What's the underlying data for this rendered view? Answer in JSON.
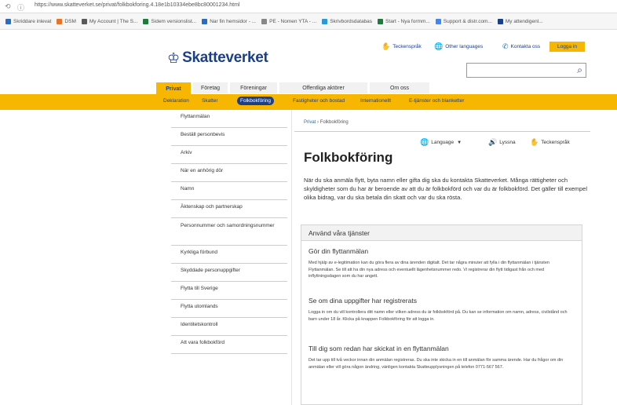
{
  "browser": {
    "url": "https://www.skatteverket.se/privat/folkbokforing.4.18e1b10334ebe8bc80001234.html",
    "bookmarks": [
      {
        "label": "Skriddare inlevat",
        "color": "#2a6cc4"
      },
      {
        "label": "DSM",
        "color": "#e8742a"
      },
      {
        "label": "My Account | The S...",
        "color": "#5a5a5a"
      },
      {
        "label": "Sidem versionslist...",
        "color": "#1f7a3e"
      },
      {
        "label": "Nar fin hemsidor - ...",
        "color": "#2a6cc4"
      },
      {
        "label": "PE - Nomen YTA - ...",
        "color": "#888888"
      },
      {
        "label": "Skrivbordsdatabas",
        "color": "#2a9ad6"
      },
      {
        "label": "Start - Nya formm...",
        "color": "#1f7a3e"
      },
      {
        "label": "Support & distr.com...",
        "color": "#4285f4"
      },
      {
        "label": "My attendigenl...",
        "color": "#1c3f8a"
      }
    ]
  },
  "header": {
    "logo_text": "Skatteverket",
    "utilities": {
      "sign_language": "Teckenspråk",
      "other_languages": "Other languages",
      "contact": "Kontakta oss",
      "login": "Logga in"
    },
    "search_placeholder": ""
  },
  "tabs": [
    {
      "label": "Privat",
      "active": true
    },
    {
      "label": "Företag",
      "active": false
    },
    {
      "label": "Föreningar",
      "active": false
    },
    {
      "label": "Offentliga aktörer",
      "active": false
    },
    {
      "label": "Om oss",
      "active": false
    }
  ],
  "subnav": [
    {
      "label": "Deklaration",
      "active": false
    },
    {
      "label": "Skatter",
      "active": false
    },
    {
      "label": "Folkbokföring",
      "active": true
    },
    {
      "label": "Fastigheter och bostad",
      "active": false
    },
    {
      "label": "Internationellt",
      "active": false
    },
    {
      "label": "E-tjänster och blanketter",
      "active": false
    }
  ],
  "sidebar": [
    "Flyttanmälan",
    "Beställ personbevis",
    "Arkiv",
    "När en anhörig dör",
    "Namn",
    "Äktenskap och partnerskap",
    "Personnummer och samordningsnummer",
    "Kyrkliga förbund",
    "Skyddade personuppgifter",
    "Flytta till Sverige",
    "Flytta utomlands",
    "Identitetskontroll",
    "Att vara folkbokförd"
  ],
  "main": {
    "breadcrumb": {
      "home": "Privat",
      "current": "Folkbokföring"
    },
    "tools": {
      "language": "Language",
      "listen": "Lyssna",
      "sign_language": "Teckenspråk"
    },
    "title": "Folkbokföring",
    "intro": "När du ska anmäla flytt, byta namn eller gifta dig ska du kontakta Skatteverket. Många rättigheter och skyldigheter som du har är beroende av att du är folkbokförd och var du är folkbokförd. Det gäller till exempel olika bidrag, var du ska betala din skatt och var du ska rösta.",
    "services": {
      "heading": "Använd våra tjänster",
      "items": [
        {
          "title": "Gör din flyttanmälan",
          "text": "Med hjälp av e-legitimation kan du göra flera av dina ärenden digitalt. Det tar några minuter att fylla i din flyttanmälan i tjänsten Flyttanmälan. Se till att ha din nya adress och eventuellt lägenhetsnummer redo. Vi registrerar din flytt tidigast från och med inflyttningsdagen som du har angett."
        },
        {
          "title": "Se om dina uppgifter har registrerats",
          "text": "Logga in om du vill kontrollera ditt namn eller vilken adress du är folkbokförd på. Du kan se information om namn, adress, civilstånd och barn under 18 år. Klicka på knappen Folkbokföring för att logga in."
        },
        {
          "title": "Till dig som redan har skickat in en flyttanmälan",
          "text": "Det tar upp till två veckor innan din anmälan registreras. Du ska inte skicka in en till anmälan för samma ärende. Har du frågor om din anmälan eller vill göra någon ändring, vänligen kontakta Skatteupplysningen på telefon 0771-567 567."
        }
      ]
    }
  }
}
